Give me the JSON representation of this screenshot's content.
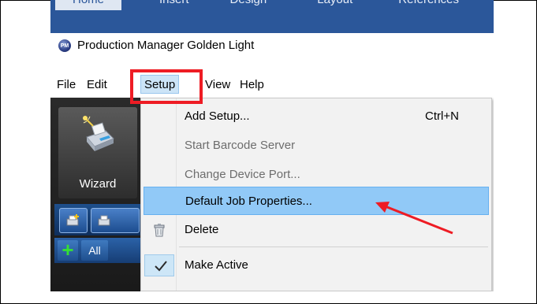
{
  "ribbon": {
    "tabs": [
      "Home",
      "Insert",
      "Design",
      "Layout",
      "References"
    ]
  },
  "app": {
    "icon_text": "PM",
    "title": "Production Manager Golden Light"
  },
  "menubar": {
    "items": [
      "File",
      "Edit",
      "Setup",
      "View",
      "Help"
    ]
  },
  "sidebar": {
    "wizard_label": "Wizard",
    "all_label": "All",
    "add_symbol": "+"
  },
  "setup_menu": {
    "items": [
      {
        "label": "Add Setup...",
        "shortcut": "Ctrl+N",
        "enabled": true
      },
      {
        "label": "Start Barcode Server",
        "shortcut": "",
        "enabled": false
      },
      {
        "label": "Change Device Port...",
        "shortcut": "",
        "enabled": false
      },
      {
        "label": "Default Job Properties...",
        "shortcut": "",
        "enabled": true,
        "highlighted": true
      },
      {
        "label": "Delete",
        "shortcut": "",
        "enabled": true,
        "icon": "trash-icon"
      },
      {
        "label": "Make Active",
        "shortcut": "",
        "enabled": true,
        "icon": "checkmark-icon"
      }
    ]
  },
  "colors": {
    "annotation_red": "#ee1c24",
    "menu_highlight": "#91c9f7",
    "ribbon_blue": "#2b579a"
  }
}
